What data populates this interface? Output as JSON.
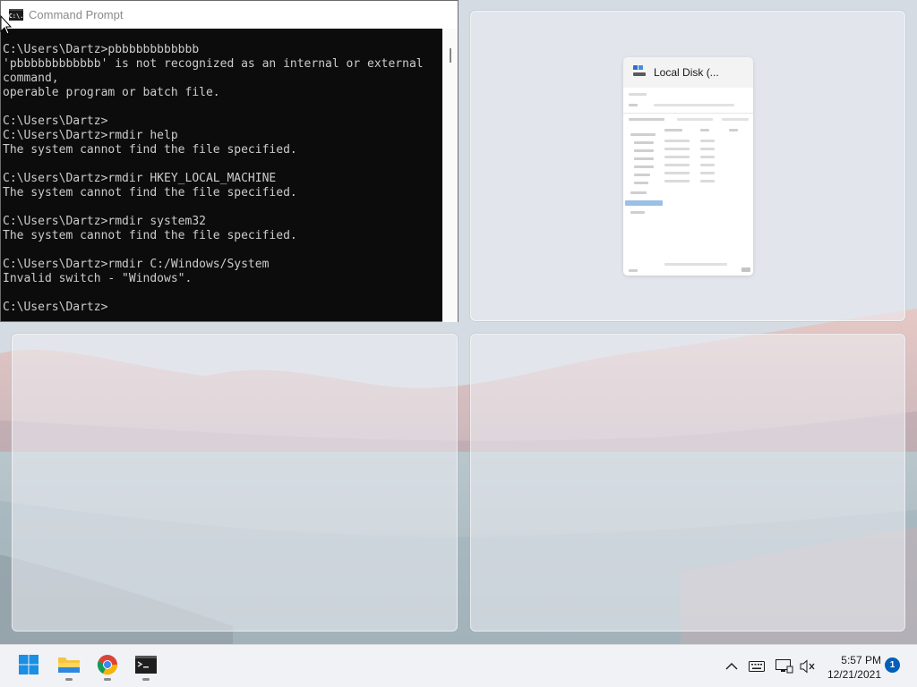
{
  "cmd": {
    "title": "Command Prompt",
    "icon_text": "C:\\.",
    "lines": [
      "C:\\Users\\Dartz>pbbbbbbbbbbbb",
      "'pbbbbbbbbbbbb' is not recognized as an internal or external",
      "command,",
      "operable program or batch file.",
      "",
      "C:\\Users\\Dartz>",
      "C:\\Users\\Dartz>rmdir help",
      "The system cannot find the file specified.",
      "",
      "C:\\Users\\Dartz>rmdir HKEY_LOCAL_MACHINE",
      "The system cannot find the file specified.",
      "",
      "C:\\Users\\Dartz>rmdir system32",
      "The system cannot find the file specified.",
      "",
      "C:\\Users\\Dartz>rmdir C:/Windows/System",
      "Invalid switch - \"Windows\".",
      "",
      "C:\\Users\\Dartz>"
    ]
  },
  "snap_assist": {
    "explorer_thumbnail_title": "Local Disk (..."
  },
  "taskbar": {
    "apps": [
      {
        "name": "start",
        "icon": "windows-logo"
      },
      {
        "name": "file-explorer",
        "icon": "folder-icon"
      },
      {
        "name": "chrome",
        "icon": "chrome-icon"
      },
      {
        "name": "command-prompt",
        "icon": "terminal-icon"
      }
    ],
    "time": "5:57 PM",
    "date": "12/21/2021",
    "notification_count": "1"
  },
  "colors": {
    "console_bg": "#0c0c0c",
    "console_text": "#cccccc",
    "accent": "#005fb8"
  }
}
